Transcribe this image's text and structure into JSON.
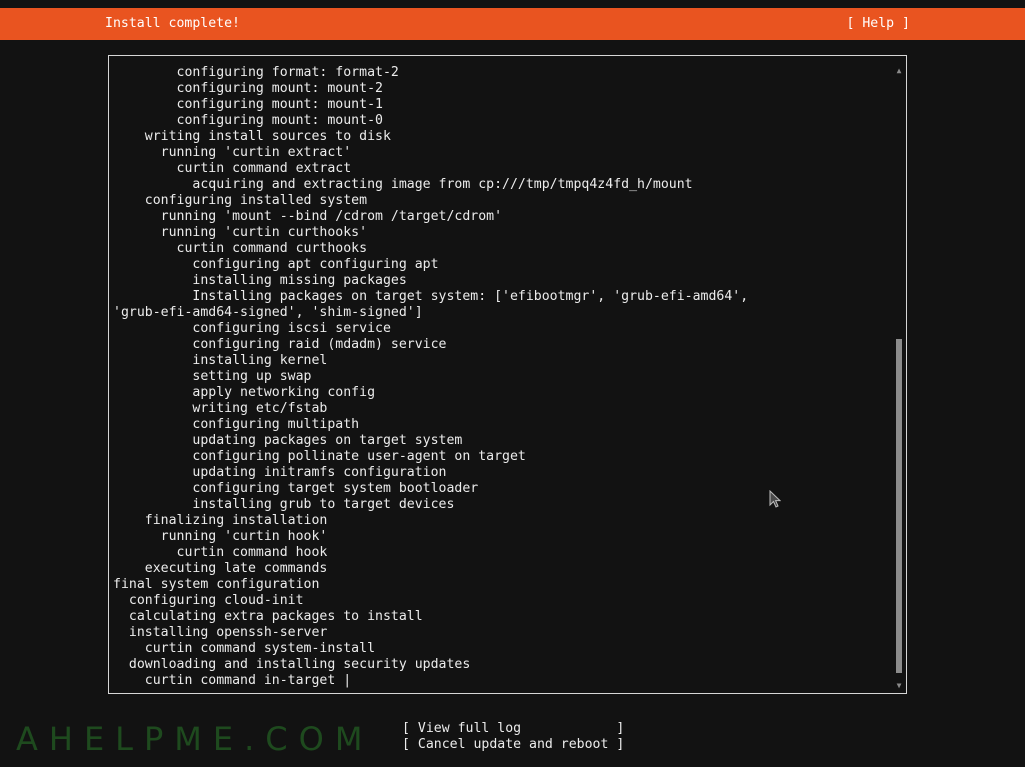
{
  "header": {
    "title": "Install complete!",
    "help_label": "[ Help ]"
  },
  "log": {
    "lines": [
      "        configuring format: format-2",
      "        configuring mount: mount-2",
      "        configuring mount: mount-1",
      "        configuring mount: mount-0",
      "    writing install sources to disk",
      "      running 'curtin extract'",
      "        curtin command extract",
      "          acquiring and extracting image from cp:///tmp/tmpq4z4fd_h/mount",
      "    configuring installed system",
      "      running 'mount --bind /cdrom /target/cdrom'",
      "      running 'curtin curthooks'",
      "        curtin command curthooks",
      "          configuring apt configuring apt",
      "          installing missing packages",
      "          Installing packages on target system: ['efibootmgr', 'grub-efi-amd64',",
      "'grub-efi-amd64-signed', 'shim-signed']",
      "          configuring iscsi service",
      "          configuring raid (mdadm) service",
      "          installing kernel",
      "          setting up swap",
      "          apply networking config",
      "          writing etc/fstab",
      "          configuring multipath",
      "          updating packages on target system",
      "          configuring pollinate user-agent on target",
      "          updating initramfs configuration",
      "          configuring target system bootloader",
      "          installing grub to target devices",
      "    finalizing installation",
      "      running 'curtin hook'",
      "        curtin command hook",
      "    executing late commands",
      "final system configuration",
      "  configuring cloud-init",
      "  calculating extra packages to install",
      "  installing openssh-server",
      "    curtin command system-install",
      "  downloading and installing security updates",
      "    curtin command in-target |"
    ],
    "scroll_position": 0.44,
    "scroll_visible_fraction": 0.56
  },
  "actions": {
    "view_log_label": "[ View full log            ]",
    "reboot_label": "[ Cancel update and reboot ]"
  },
  "watermark": "AHELPME.COM",
  "colors": {
    "accent": "#e95420",
    "background": "#121212",
    "text": "#ececec"
  }
}
